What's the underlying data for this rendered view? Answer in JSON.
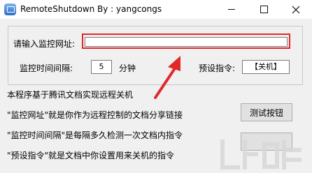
{
  "window": {
    "title": "RemoteShutdown  By : yangcongs"
  },
  "form": {
    "url_label": "请输入监控网址:",
    "url_value": "",
    "interval_label": "监控时间间隔:",
    "interval_value": "5",
    "interval_unit": "分钟",
    "command_label": "预设指令:",
    "command_value": "【关机】"
  },
  "info": {
    "line1": "本程序基于腾讯文档实现远程关机",
    "line2": "\"监控网址\"就是你作为远程控制的文档分享链接",
    "line3": "\"监控时间间隔\"是每隔多久检测一次文档内指令",
    "line4": "\"预设指令\"就是文档中你设置用来关机的指令"
  },
  "buttons": {
    "test": "测试按钮"
  },
  "colors": {
    "highlight": "#e02a2a",
    "window_bg": "#f0f0f0"
  }
}
